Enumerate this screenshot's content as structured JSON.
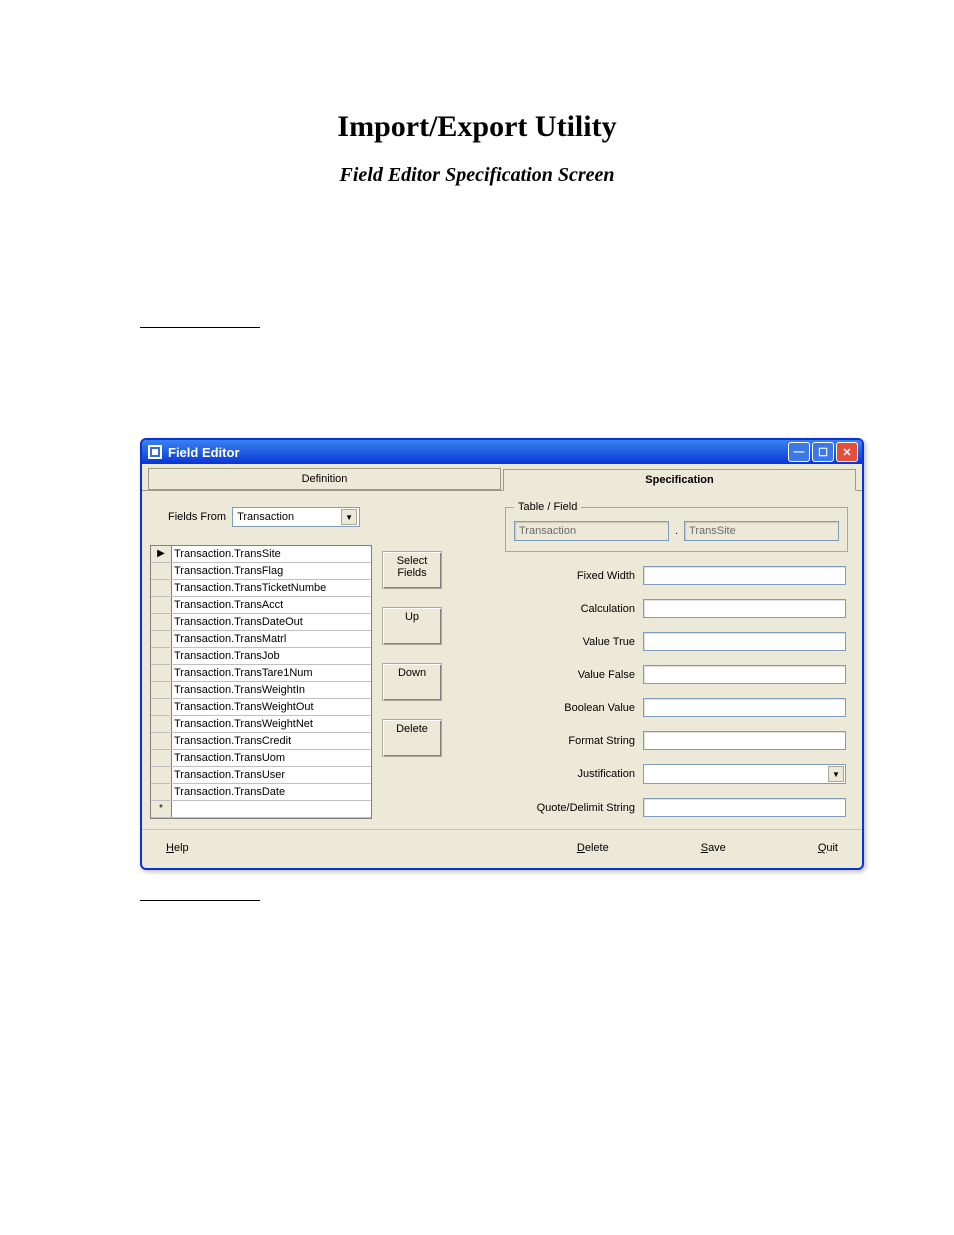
{
  "document": {
    "title": "Import/Export Utility",
    "subtitle": "Field Editor Specification Screen"
  },
  "window": {
    "title": "Field Editor"
  },
  "tabs": {
    "definition": "Definition",
    "specification": "Specification"
  },
  "left": {
    "fields_from_label": "Fields From",
    "fields_from_value": "Transaction",
    "grid_rows": [
      "Transaction.TransSite",
      "Transaction.TransFlag",
      "Transaction.TransTicketNumbe",
      "Transaction.TransAcct",
      "Transaction.TransDateOut",
      "Transaction.TransMatrl",
      "Transaction.TransJob",
      "Transaction.TransTare1Num",
      "Transaction.TransWeightIn",
      "Transaction.TransWeightOut",
      "Transaction.TransWeightNet",
      "Transaction.TransCredit",
      "Transaction.TransUom",
      "Transaction.TransUser",
      "Transaction.TransDate"
    ],
    "current_row_marker": "▶",
    "new_row_marker": "*",
    "buttons": {
      "select_fields": "Select Fields",
      "up": "Up",
      "down": "Down",
      "delete": "Delete"
    }
  },
  "right": {
    "table_field_legend": "Table / Field",
    "table_value": "Transaction",
    "field_value": "TransSite",
    "labels": {
      "fixed_width": "Fixed Width",
      "calculation": "Calculation",
      "value_true": "Value True",
      "value_false": "Value False",
      "boolean_value": "Boolean Value",
      "format_string": "Format String",
      "justification": "Justification",
      "quote_delimit": "Quote/Delimit String"
    }
  },
  "bottom": {
    "help": "Help",
    "delete": "Delete",
    "save": "Save",
    "quit": "Quit"
  }
}
